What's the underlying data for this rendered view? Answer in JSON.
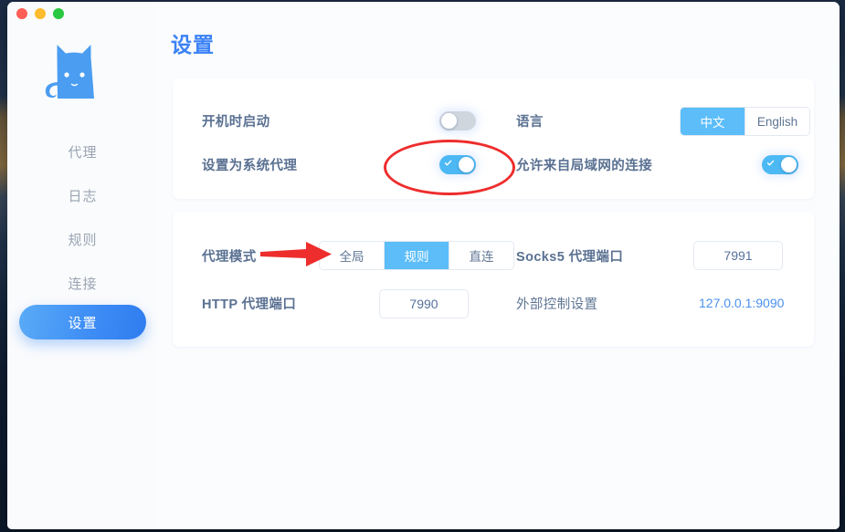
{
  "window": {
    "traffic_lights": [
      {
        "name": "close",
        "color": "#ff5f57"
      },
      {
        "name": "minimize",
        "color": "#febc2e"
      },
      {
        "name": "zoom",
        "color": "#28c840"
      }
    ]
  },
  "sidebar": {
    "logo_name": "cat-logo",
    "items": [
      {
        "label": "代理",
        "active": false
      },
      {
        "label": "日志",
        "active": false
      },
      {
        "label": "规则",
        "active": false
      },
      {
        "label": "连接",
        "active": false
      },
      {
        "label": "设置",
        "active": true
      }
    ]
  },
  "main": {
    "title": "设置",
    "cards": [
      {
        "name": "general-card",
        "rows": [
          {
            "label": "开机时启动",
            "control": "switch",
            "state": "off"
          },
          {
            "label": "语言",
            "control": "segmented",
            "options": [
              "中文",
              "English"
            ],
            "selected": "中文"
          },
          {
            "label": "设置为系统代理",
            "control": "switch",
            "state": "on"
          },
          {
            "label": "允许来自局域网的连接",
            "control": "switch",
            "state": "on"
          }
        ]
      },
      {
        "name": "proxy-card",
        "rows": [
          {
            "label": "代理模式",
            "control": "segmented",
            "options": [
              "全局",
              "规则",
              "直连"
            ],
            "selected": "规则"
          },
          {
            "label": "Socks5 代理端口",
            "control": "input",
            "value": "7991"
          },
          {
            "label": "HTTP 代理端口",
            "control": "input",
            "value": "7990"
          },
          {
            "label": "外部控制设置",
            "control": "link",
            "value": "127.0.0.1:9090"
          }
        ]
      }
    ]
  },
  "annotations": {
    "ellipse": {
      "name": "highlight-ellipse",
      "color": "#ee2d2d",
      "target": "设置为系统代理 switch"
    },
    "arrow": {
      "name": "pointer-arrow",
      "color": "#ee2d2d",
      "target": "代理模式 segmented control"
    }
  },
  "colors": {
    "accent": "#3b82f6",
    "switch_on": "#4db9f4",
    "switch_off": "#cfd6de",
    "segment_selected": "#5cbdf9",
    "label": "#5a7192",
    "annotation": "#ee2d2d",
    "card_bg": "#ffffff",
    "app_bg": "#fbfcfe"
  }
}
